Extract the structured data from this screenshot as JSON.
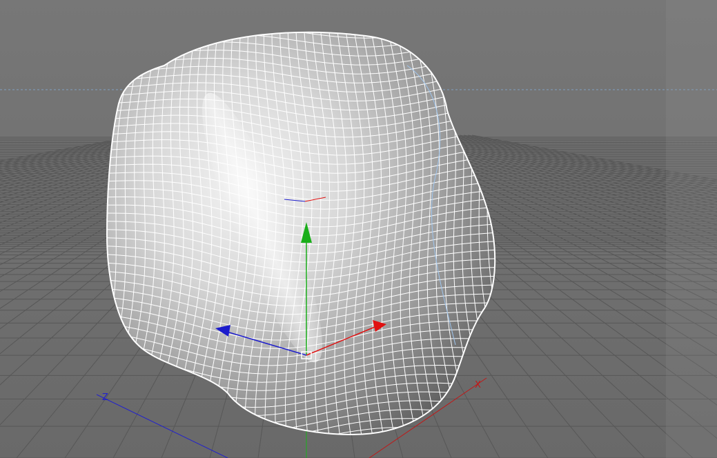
{
  "viewport": {
    "background_top": "#777777",
    "background_bottom": "#6a6a6a",
    "grid_color": "#575757",
    "horizon_line_color": "#7f9fc0",
    "object_fill": "#c9c9c9",
    "wire_color": "#ffffff",
    "selection_outline_color": "#9fc6ef"
  },
  "axes": {
    "x": {
      "label": "X",
      "color": "#c01818"
    },
    "y": {
      "color": "#19b41a"
    },
    "z": {
      "label": "Z",
      "color": "#2222cc"
    }
  },
  "gizmo": {
    "x_color": "#e01010",
    "y_color": "#1aae1a",
    "z_color": "#1c1ccc"
  },
  "icons": [
    "move-gizmo-icon",
    "axis-cone-icon"
  ]
}
